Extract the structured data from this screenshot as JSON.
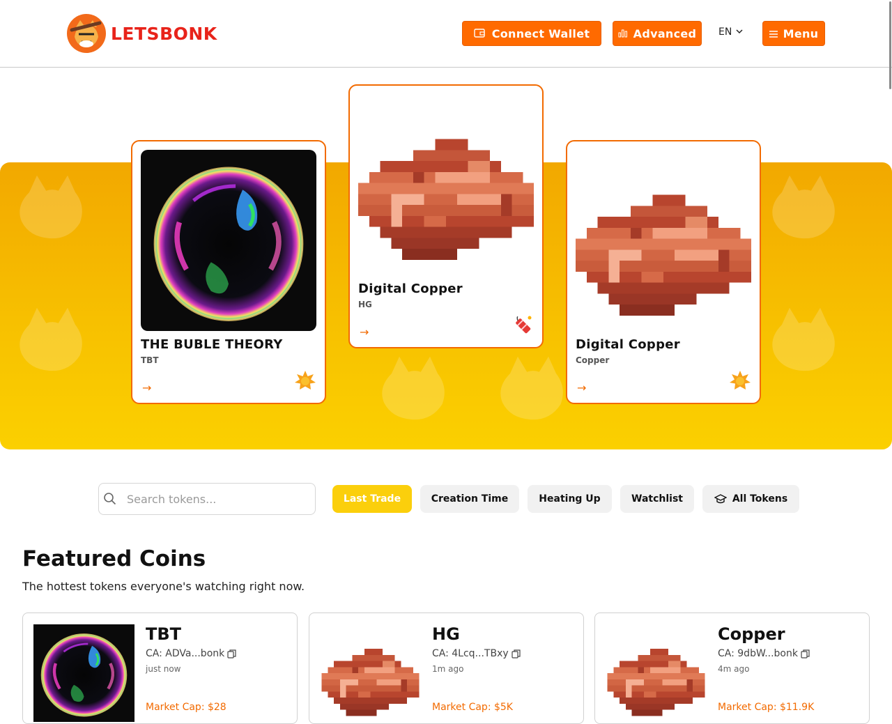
{
  "header": {
    "logo_text": "LETSBONK",
    "connect_wallet": "Connect Wallet",
    "advanced": "Advanced",
    "language": "EN",
    "menu": "Menu"
  },
  "colors": {
    "brand_orange": "#ff6a00",
    "brand_red": "#e8231a",
    "hero_yellow": "#f7c000",
    "active_pill": "#fbcf0c"
  },
  "hero_cards": [
    {
      "title": "THE BUBLE THEORY",
      "symbol": "TBT",
      "arrow": "→",
      "badge": "star-burst-icon"
    },
    {
      "title": "Digital Copper",
      "symbol": "HG",
      "arrow": "→",
      "badge": "firecracker-icon"
    },
    {
      "title": "Digital Copper",
      "symbol": "Copper",
      "arrow": "→",
      "badge": "star-burst-icon"
    }
  ],
  "search": {
    "placeholder": "Search tokens..."
  },
  "filters": [
    "Last Trade",
    "Creation Time",
    "Heating Up",
    "Watchlist",
    "All Tokens"
  ],
  "featured": {
    "title": "Featured Coins",
    "subtitle": "The hottest tokens everyone's watching right now.",
    "coins": [
      {
        "name": "TBT",
        "ca": "CA: ADVa...bonk",
        "time": "just now",
        "market_cap": "Market Cap: $28"
      },
      {
        "name": "HG",
        "ca": "CA: 4Lcq...TBxy",
        "time": "1m ago",
        "market_cap": "Market Cap: $5K"
      },
      {
        "name": "Copper",
        "ca": "CA: 9dbW...bonk",
        "time": "4m ago",
        "market_cap": "Market Cap: $11.9K"
      }
    ]
  }
}
